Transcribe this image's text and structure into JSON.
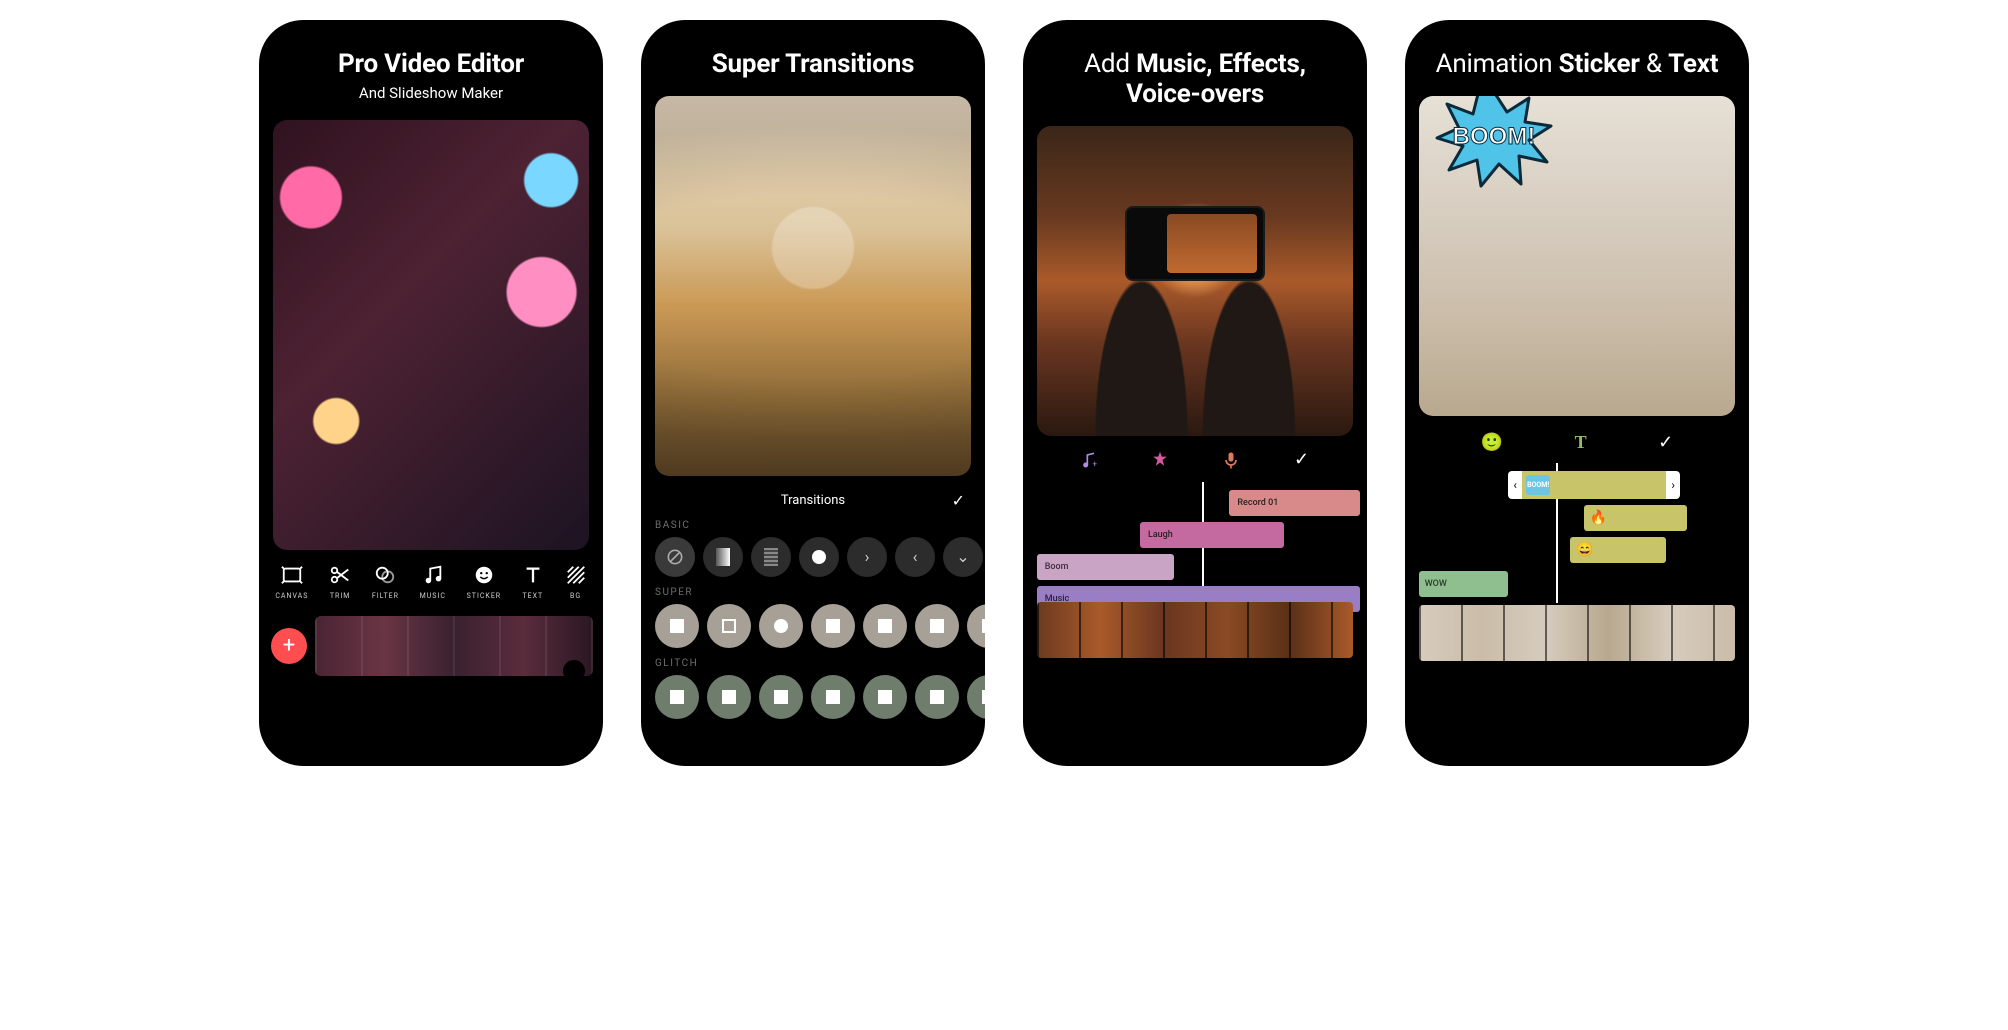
{
  "screens": [
    {
      "title_bold": "Pro Video Editor",
      "subtitle": "And Slideshow Maker",
      "tools": [
        {
          "id": "canvas",
          "label": "CANVAS"
        },
        {
          "id": "trim",
          "label": "TRIM"
        },
        {
          "id": "filter",
          "label": "FILTER"
        },
        {
          "id": "music",
          "label": "MUSIC"
        },
        {
          "id": "sticker",
          "label": "STICKER"
        },
        {
          "id": "text",
          "label": "TEXT"
        },
        {
          "id": "bg",
          "label": "BG"
        }
      ],
      "add_button": "+",
      "colors": {
        "add_btn": "#ff4d50"
      }
    },
    {
      "title_bold": "Super Transitions",
      "panel_title": "Transitions",
      "sections": [
        {
          "name": "BASIC"
        },
        {
          "name": "SUPER"
        },
        {
          "name": "GLITCH"
        }
      ]
    },
    {
      "title_light_pre": "Add ",
      "title_bold_a": "Music, Effects,",
      "title_bold_b": "Voice-overs",
      "tracks": {
        "record": "Record 01",
        "laugh": "Laugh",
        "boom": "Boom",
        "music": "Music"
      },
      "track_colors": {
        "record": "#d88a8a",
        "laugh": "#c56aa0",
        "boom": "#caa4c5",
        "music": "#9a7ec5"
      }
    },
    {
      "title_light_pre": "Animation ",
      "title_bold_a": "Sticker",
      "title_mid": " & ",
      "title_bold_b": "Text",
      "boom_text": "BOOM!",
      "mini_sticker": "BOOM!",
      "emoji_fire": "🔥",
      "emoji_grin": "😄",
      "wow": "WOW",
      "icon_smile": "🙂",
      "boom_color": "#4fc3e8"
    }
  ]
}
